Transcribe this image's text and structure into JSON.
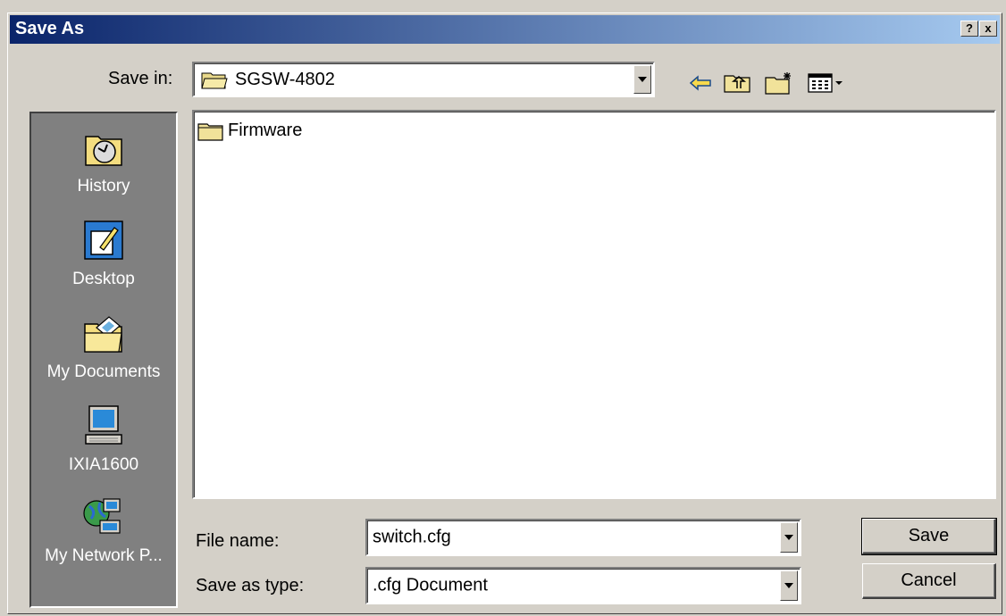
{
  "window": {
    "title": "Save As",
    "help_label": "?",
    "close_label": "x"
  },
  "save_in": {
    "label": "Save in:",
    "value": "SGSW-4802"
  },
  "toolbar": {
    "back_icon": "back-arrow-icon",
    "up_icon": "up-folder-icon",
    "new_folder_icon": "new-folder-icon",
    "view_icon": "view-menu-icon"
  },
  "places": [
    {
      "label": "History",
      "icon": "history-icon"
    },
    {
      "label": "Desktop",
      "icon": "desktop-icon"
    },
    {
      "label": "My Documents",
      "icon": "my-documents-icon"
    },
    {
      "label": "IXIA1600",
      "icon": "computer-icon"
    },
    {
      "label": "My Network P...",
      "icon": "network-places-icon"
    }
  ],
  "files": [
    {
      "name": "Firmware",
      "icon": "folder-icon"
    }
  ],
  "file_name": {
    "label": "File name:",
    "value": "switch.cfg"
  },
  "save_type": {
    "label": "Save as type:",
    "value": ".cfg Document"
  },
  "buttons": {
    "save": "Save",
    "cancel": "Cancel"
  }
}
